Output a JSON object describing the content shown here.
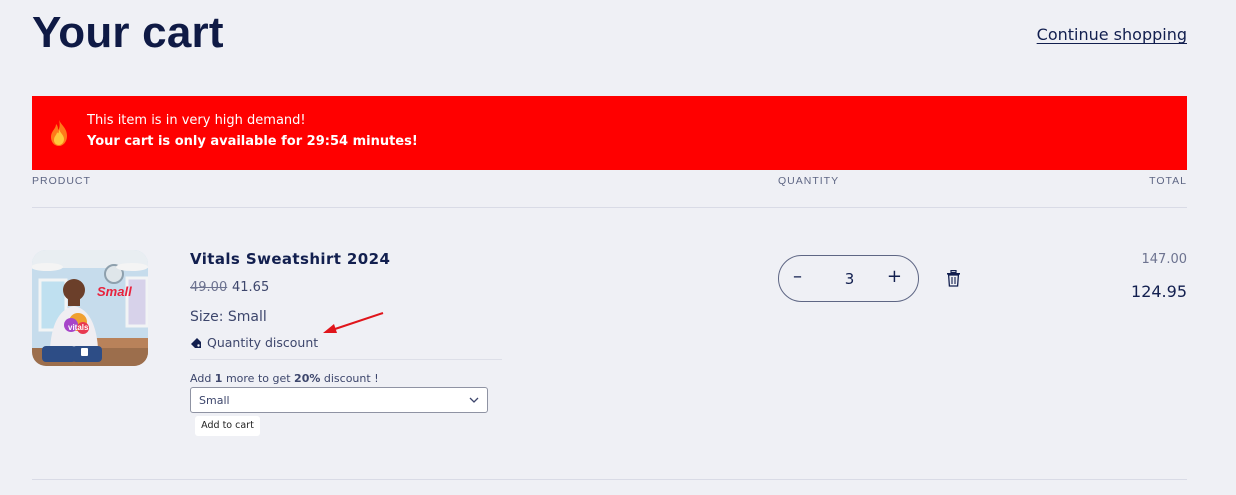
{
  "header": {
    "title": "Your cart",
    "continue_link": "Continue shopping"
  },
  "banner": {
    "line1": "This item is in very high demand!",
    "line2": "Your cart is only available for 29:54 minutes!",
    "icon": "fire-icon",
    "color": "#ff0000"
  },
  "columns": {
    "product": "PRODUCT",
    "quantity": "QUANTITY",
    "total": "TOTAL"
  },
  "item": {
    "name": "Vitals Sweatshirt 2024",
    "price_original": "49.00",
    "price_current": "41.65",
    "size": "Size: Small",
    "discount_label": "Quantity discount",
    "quantity": "3",
    "total_original": "147.00",
    "total_current": "124.95",
    "image_label": "Small",
    "image_shirt_text": "vitals"
  },
  "upsell": {
    "prefix": "Add ",
    "count": "1",
    "middle": " more to get ",
    "percent": "20%",
    "suffix": " discount !",
    "select_value": "Small",
    "add_button": "Add to cart"
  }
}
